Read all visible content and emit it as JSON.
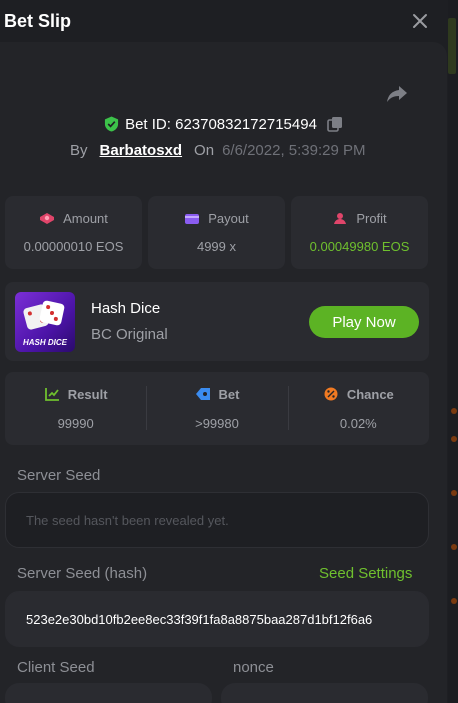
{
  "header": {
    "title": "Bet Slip"
  },
  "bet": {
    "id_label": "Bet ID: 62370832172715494",
    "by_label": "By",
    "user": "Barbatosxd",
    "on_label": "On",
    "date": "6/6/2022, 5:39:29 PM"
  },
  "stats": [
    {
      "label": "Amount",
      "value": "0.00000010 EOS",
      "icon": "amount-icon"
    },
    {
      "label": "Payout",
      "value": "4999 x",
      "icon": "wallet-icon"
    },
    {
      "label": "Profit",
      "value": "0.00049980 EOS",
      "icon": "profit-icon"
    }
  ],
  "game": {
    "thumb_text": "HASH DICE",
    "name": "Hash Dice",
    "subtitle": "BC Original",
    "play_label": "Play Now"
  },
  "result": [
    {
      "label": "Result",
      "value": "99990",
      "icon": "result-icon"
    },
    {
      "label": "Bet",
      "value": ">99980",
      "icon": "bet-tag-icon"
    },
    {
      "label": "Chance",
      "value": "0.02%",
      "icon": "percent-icon"
    }
  ],
  "seeds": {
    "server_seed_label": "Server Seed",
    "server_seed_value": "The seed hasn't been revealed yet.",
    "server_hash_label": "Server Seed (hash)",
    "seed_settings_label": "Seed Settings",
    "server_hash_value": "523e2e30bd10fb2ee8ec33f39f1fa8a8875baa287d1bf12f6a6",
    "client_seed_label": "Client Seed",
    "nonce_label": "nonce"
  },
  "colors": {
    "accent_green": "#5cb324",
    "profit_green": "#6fc02e",
    "background": "#1e1f23"
  }
}
